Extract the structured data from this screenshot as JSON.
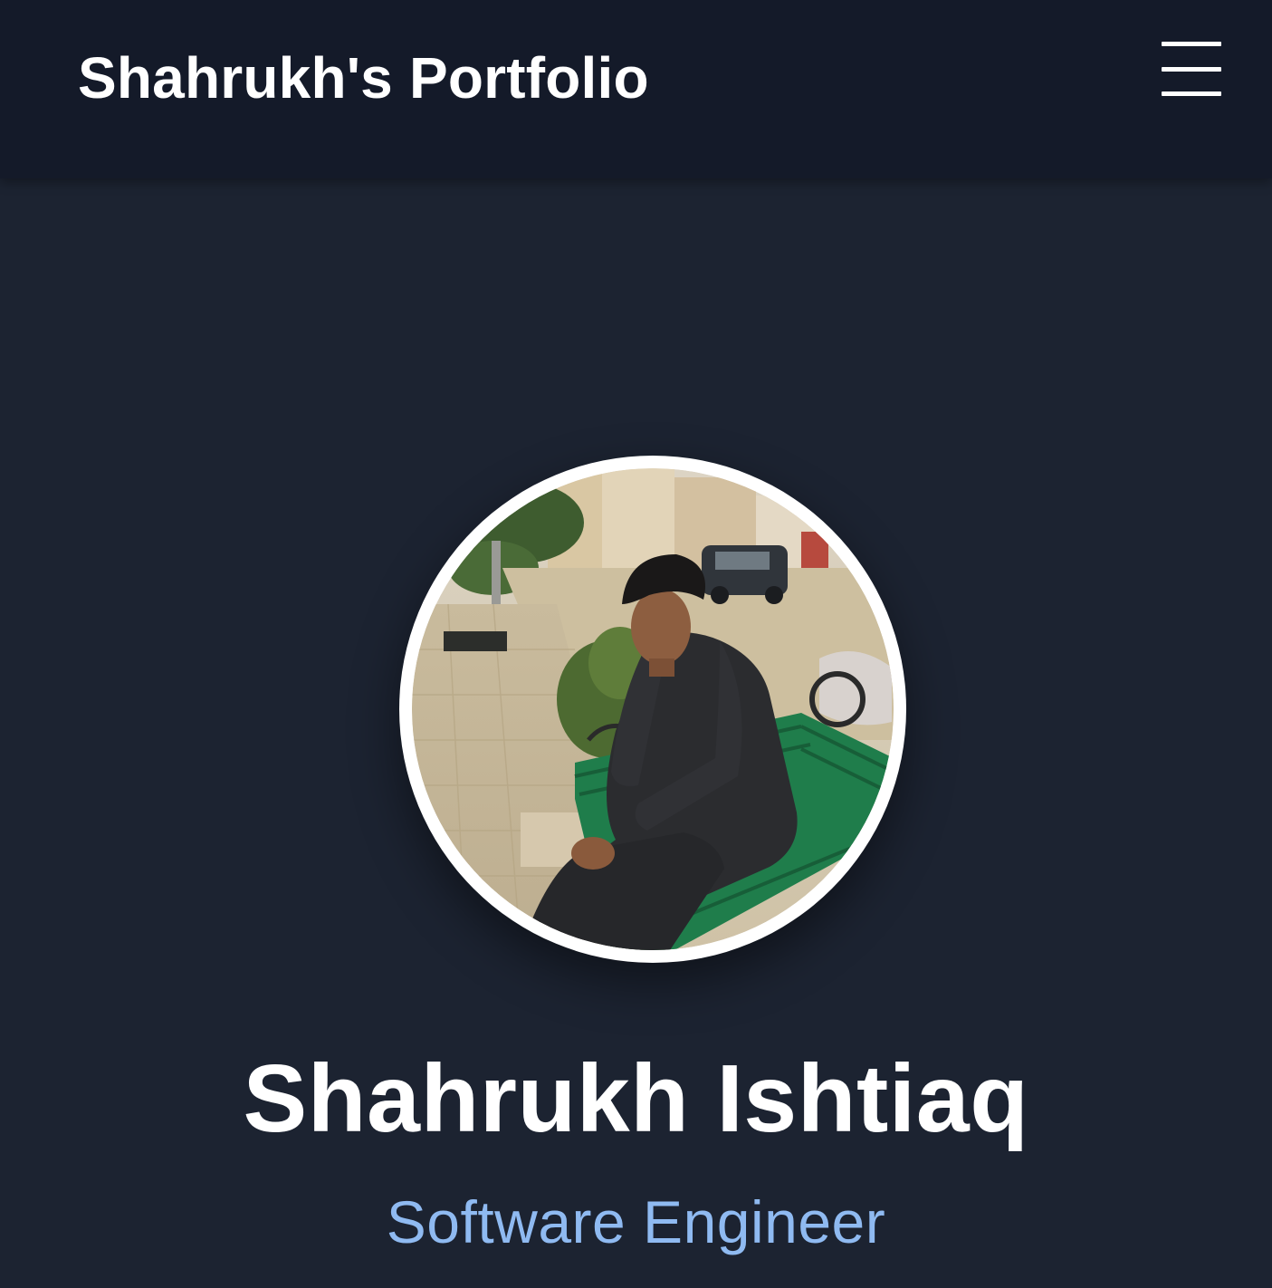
{
  "navbar": {
    "brand": "Shahrukh's Portfolio",
    "menu_icon": "hamburger-menu-icon"
  },
  "hero": {
    "name": "Shahrukh Ishtiaq",
    "role": "Software Engineer",
    "avatar_icon": "profile-photo"
  },
  "colors": {
    "navbar_bg": "#141a29",
    "page_bg": "#1c2331",
    "text_primary": "#ffffff",
    "accent": "#8fbaf1"
  }
}
